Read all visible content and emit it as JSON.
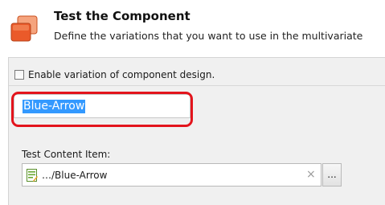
{
  "header": {
    "title": "Test the Component",
    "description": "Define the variations that you want to use in the multivariate"
  },
  "variation": {
    "checkbox_label": "Enable variation of component design.",
    "checked": false,
    "name_value": "Blue-Arrow"
  },
  "test_content": {
    "label": "Test Content Item:",
    "value": "…/Blue-Arrow",
    "clear_glyph": "×",
    "browse_label": "..."
  },
  "colors": {
    "highlight": "#e3141c",
    "selection": "#3399ff",
    "icon_orange": "#ea5a2a"
  }
}
